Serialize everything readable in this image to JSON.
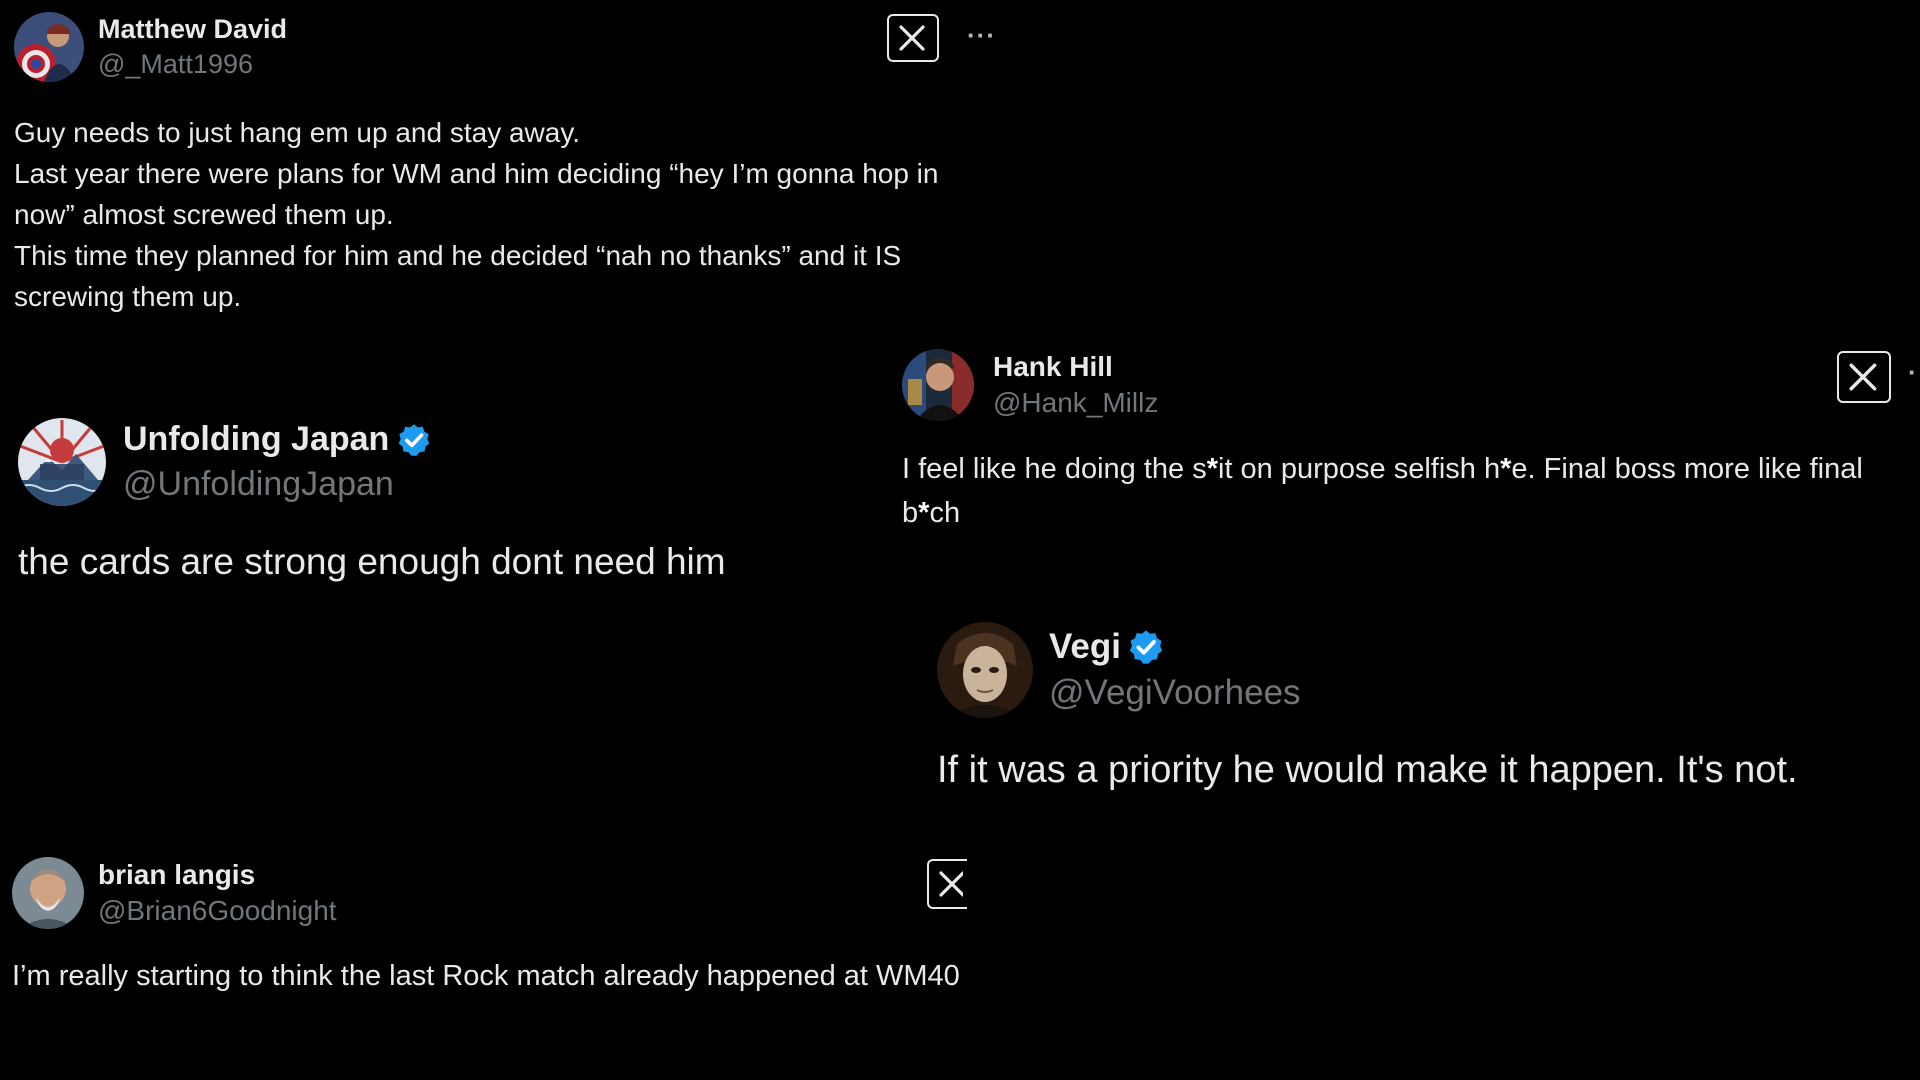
{
  "colors": {
    "background": "#000000",
    "text": "#e7e9ea",
    "handle": "#71767b",
    "verified_badge": "#1d9bf0"
  },
  "tweets": [
    {
      "name": "Matthew David",
      "handle": "@_Matt1996",
      "verified": false,
      "text": "Guy needs to just hang em up and stay away.\nLast year there were plans for WM and him deciding “hey I’m gonna hop in now” almost screwed them up.\nThis time they planned for him and he decided “nah no thanks” and it IS screwing them up.",
      "avatar_icon": "captain-america-avatar",
      "has_x_button": true,
      "more_label": "···"
    },
    {
      "name": "Unfolding Japan",
      "handle": "@UnfoldingJapan",
      "verified": true,
      "text": "the cards are strong enough dont need him",
      "avatar_icon": "japan-circle-logo-avatar",
      "avatar_logo_text": "Unfolding Japan"
    },
    {
      "name": "Hank Hill",
      "handle": "@Hank_Millz",
      "verified": false,
      "text_parts": [
        "I feel like he doing the s",
        "*",
        "it on purpose selfish h",
        "*",
        "e. Final boss more like final b",
        "*",
        "ch"
      ],
      "avatar_icon": "person-photo-avatar",
      "has_x_button": true,
      "more_label": "·"
    },
    {
      "name": "Vegi",
      "handle": "@VegiVoorhees",
      "verified": true,
      "text": "If it was a priority he would make it happen. It's not.",
      "avatar_icon": "mask-face-avatar"
    },
    {
      "name": "brian langis",
      "handle": "@Brian6Goodnight",
      "verified": false,
      "text": "I’m really starting to think the last Rock match already happened at WM40",
      "avatar_icon": "older-man-photo-avatar",
      "has_x_button": true
    }
  ]
}
